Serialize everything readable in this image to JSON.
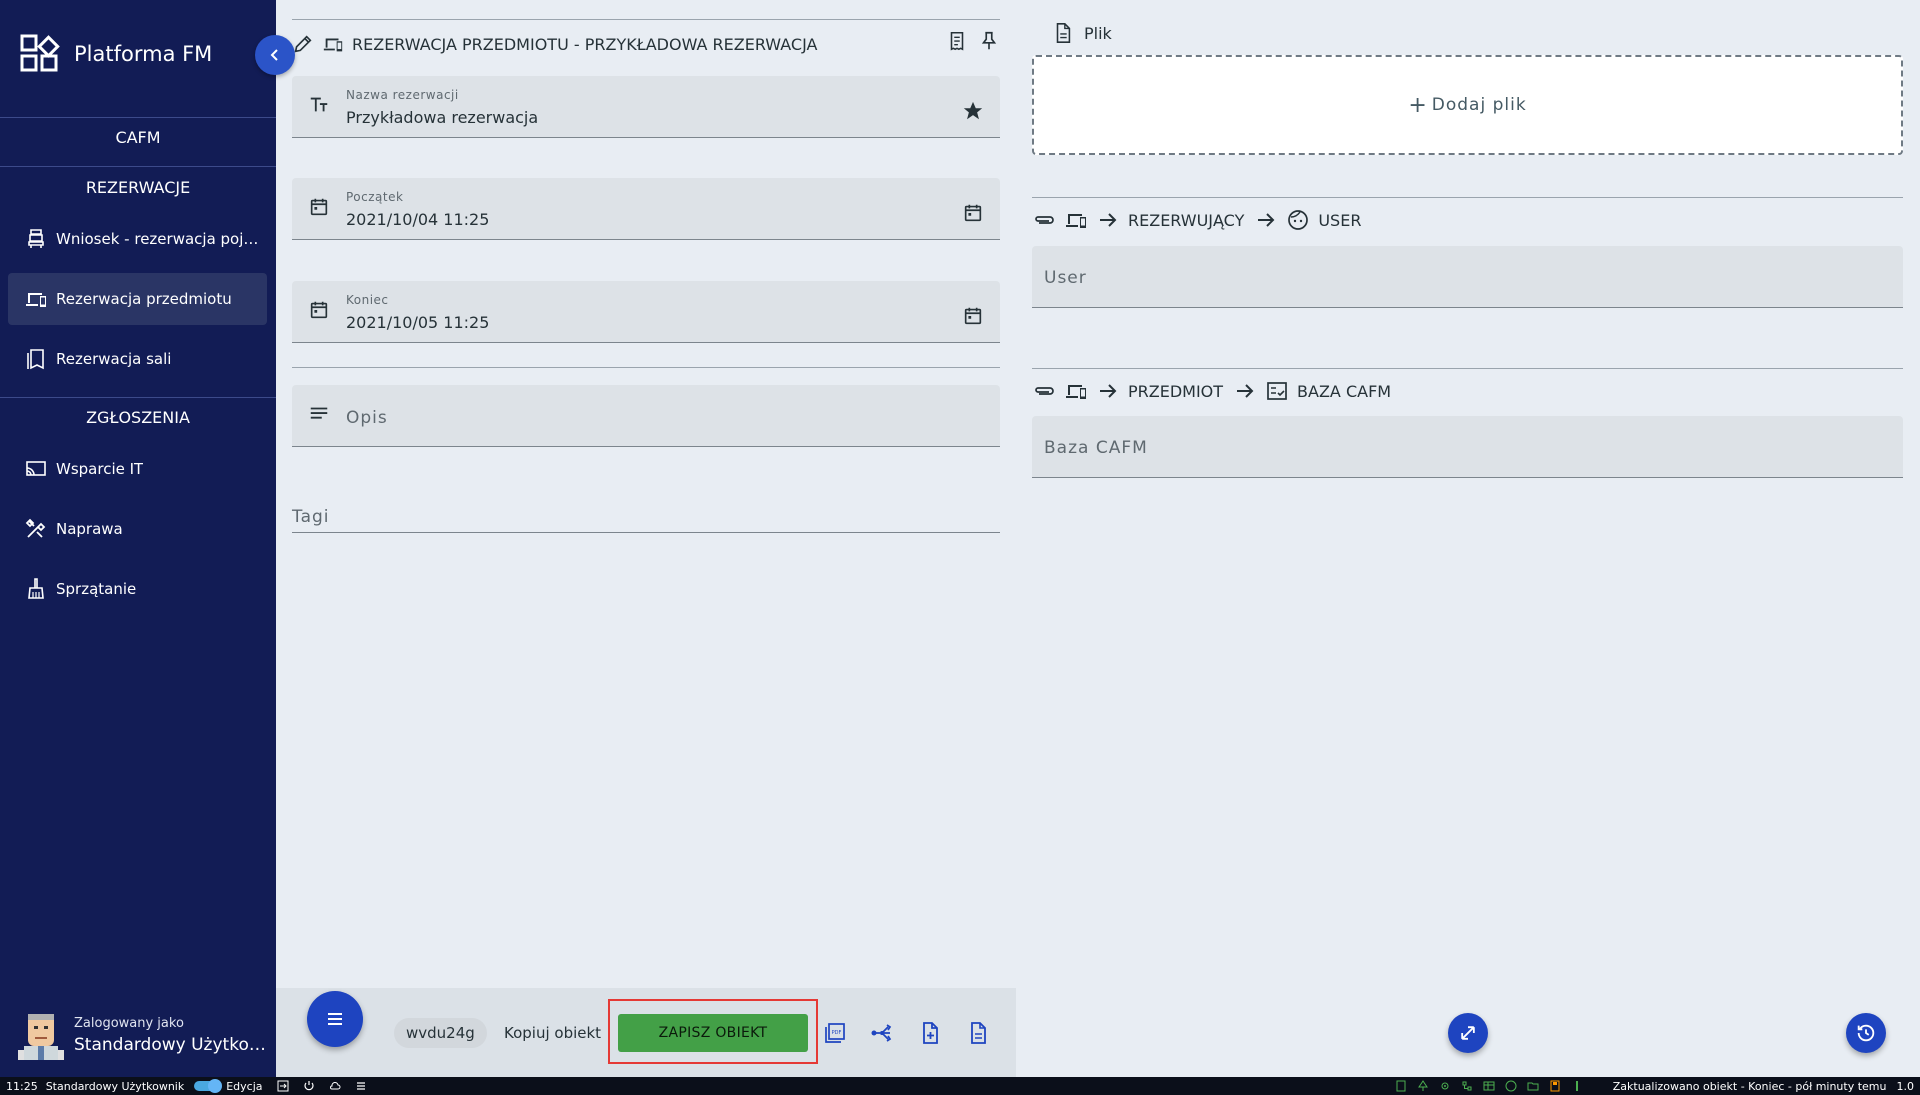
{
  "app": {
    "title": "Platforma FM"
  },
  "sidebar": {
    "cafm": "CAFM",
    "section_reservations": "REZERWACJE",
    "section_tickets": "ZGŁOSZENIA",
    "items": [
      {
        "label": "Wniosek - rezerwacja pojazdu",
        "icon": "car-seat-icon"
      },
      {
        "label": "Rezerwacja przedmiotu",
        "icon": "devices-icon",
        "active": true
      },
      {
        "label": "Rezerwacja sali",
        "icon": "bookmark-icon"
      },
      {
        "label": "Wsparcie IT",
        "icon": "cast-icon"
      },
      {
        "label": "Naprawa",
        "icon": "tools-icon"
      },
      {
        "label": "Sprzątanie",
        "icon": "broom-icon"
      }
    ],
    "user": {
      "caption": "Zalogowany jako",
      "name": "Standardowy Użytkownik"
    }
  },
  "form": {
    "header": "REZERWACJA PRZEDMIOTU - PRZYKŁADOWA REZERWACJA",
    "fields": {
      "name": {
        "label": "Nazwa rezerwacji",
        "value": "Przykładowa rezerwacja"
      },
      "start": {
        "label": "Początek",
        "value": "2021/10/04 11:25"
      },
      "end": {
        "label": "Koniec",
        "value": "2021/10/05 11:25"
      },
      "description": {
        "placeholder": "Opis"
      },
      "tags": {
        "placeholder": "Tagi"
      }
    }
  },
  "right": {
    "file_title": "Plik",
    "add_file": "Dodaj plik",
    "relation1": {
      "a": "REZERWUJĄCY",
      "b": "USER",
      "field": "User"
    },
    "relation2": {
      "a": "PRZEDMIOT",
      "b": "BAZA CAFM",
      "field": "Baza CAFM"
    }
  },
  "actions": {
    "object_id": "wvdu24g",
    "copy_label": "Kopiuj obiekt",
    "save_label": "ZAPISZ OBIEKT"
  },
  "status_bar": {
    "time": "11:25",
    "user": "Standardowy Użytkownik",
    "mode": "Edycja",
    "message": "Zaktualizowano obiekt - Koniec - pół minuty temu",
    "version": "1.0"
  }
}
